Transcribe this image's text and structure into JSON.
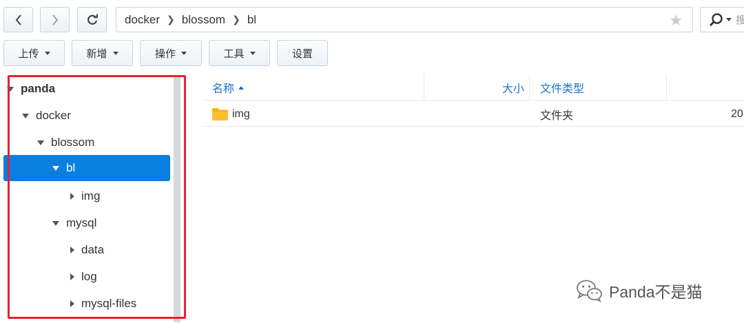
{
  "nav": {
    "back_icon": "chevron-left-icon",
    "forward_icon": "chevron-right-icon",
    "refresh_icon": "refresh-icon",
    "path": [
      "docker",
      "blossom",
      "bl"
    ],
    "favorite_icon": "star-icon",
    "search_icon": "search-icon",
    "search_partial_text": "搜"
  },
  "toolbar": {
    "upload_label": "上传",
    "create_label": "新增",
    "action_label": "操作",
    "tools_label": "工具",
    "settings_label": "设置"
  },
  "tree": {
    "items": [
      {
        "label": "panda",
        "state": "expanded",
        "bold": true
      },
      {
        "label": "docker",
        "state": "expanded"
      },
      {
        "label": "blossom",
        "state": "expanded"
      },
      {
        "label": "bl",
        "state": "expanded",
        "selected": true
      },
      {
        "label": "img",
        "state": "collapsed"
      },
      {
        "label": "mysql",
        "state": "expanded"
      },
      {
        "label": "data",
        "state": "collapsed"
      },
      {
        "label": "log",
        "state": "collapsed"
      },
      {
        "label": "mysql-files",
        "state": "collapsed"
      }
    ]
  },
  "file_list": {
    "columns": {
      "name": "名称",
      "size": "大小",
      "type": "文件类型"
    },
    "rows": [
      {
        "name": "img",
        "size": "",
        "type": "文件夹",
        "modified": "20",
        "icon": "folder-icon"
      }
    ]
  },
  "watermark": {
    "text": "Panda不是猫",
    "icon": "wechat-icon"
  },
  "colors": {
    "accent": "#0a7fe0",
    "highlight": "#e8212a",
    "folder": "#f5b01c",
    "header_text": "#1a73c8"
  }
}
